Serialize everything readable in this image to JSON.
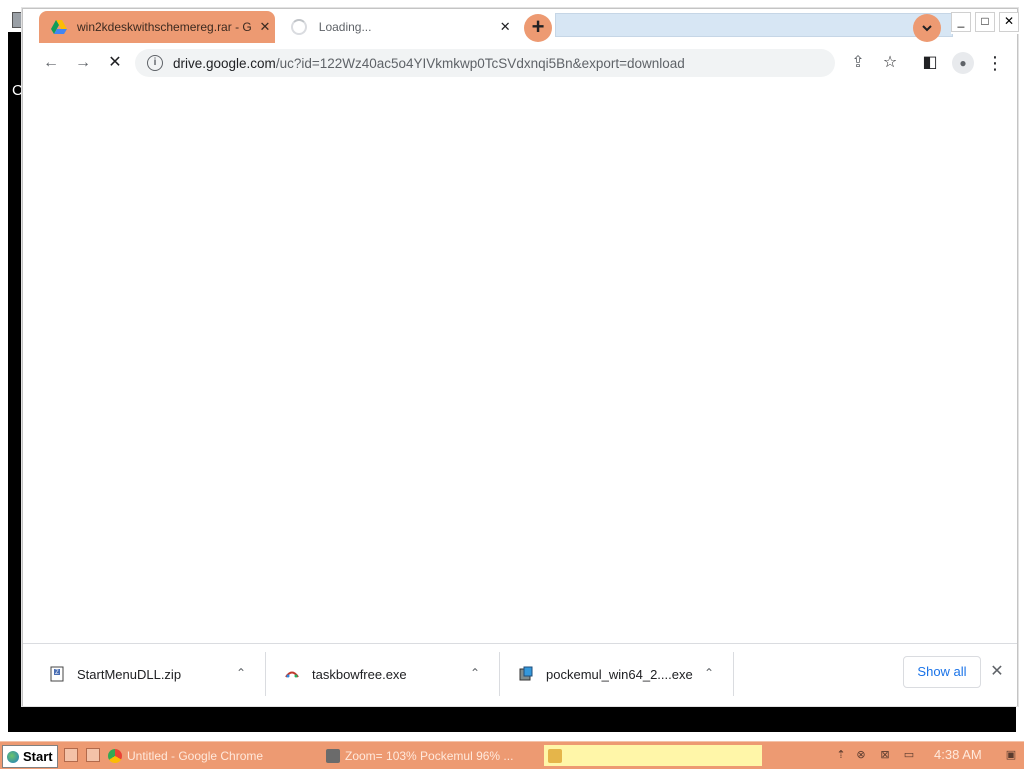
{
  "browser": {
    "tabs": [
      {
        "title": "win2kdeskwithschemereg.rar - G",
        "active": true,
        "favicon": "google-drive-icon"
      },
      {
        "title": "Loading...",
        "active": false,
        "favicon": "loading-spinner-icon"
      }
    ],
    "new_tab_label": "+",
    "tab_search_label": "⌄",
    "window_controls": {
      "minimize": "_",
      "maximize": "□",
      "close": "✕"
    },
    "toolbar": {
      "back_icon": "←",
      "forward_icon": "→",
      "stop_icon": "✕",
      "info_icon": "i",
      "url_host": "drive.google.com",
      "url_path": "/uc?id=122Wz40ac5o4YIVkmkwp0TcSVdxnqi5Bn&export=download",
      "share_icon": "⇪",
      "bookmark_icon": "☆",
      "sidepanel_icon": "◧",
      "profile_icon": "●",
      "menu_icon": "⋮"
    }
  },
  "downloads": {
    "items": [
      {
        "name": "StartMenuDLL.zip",
        "icon": "zip-file-icon"
      },
      {
        "name": "taskbowfree.exe",
        "icon": "exe-file-icon"
      },
      {
        "name": "pockemul_win64_2....exe",
        "icon": "installer-icon"
      }
    ],
    "chevron": "⌃",
    "show_all_label": "Show all",
    "close_label": "✕"
  },
  "taskbar": {
    "start_label": "Start",
    "tasks": [
      {
        "label": "Untitled - Google Chrome",
        "icon_color": "#4285f4"
      },
      {
        "label": "Zoom= 103% Pockemul 96% ...",
        "icon_color": "#6b6b6b"
      },
      {
        "label": "",
        "icon_color": "#e5b54a"
      }
    ],
    "clock": "4:38 AM"
  },
  "colors": {
    "accent": "#ed9a72",
    "desktop": "#000000",
    "link_blue": "#1a73e8"
  }
}
